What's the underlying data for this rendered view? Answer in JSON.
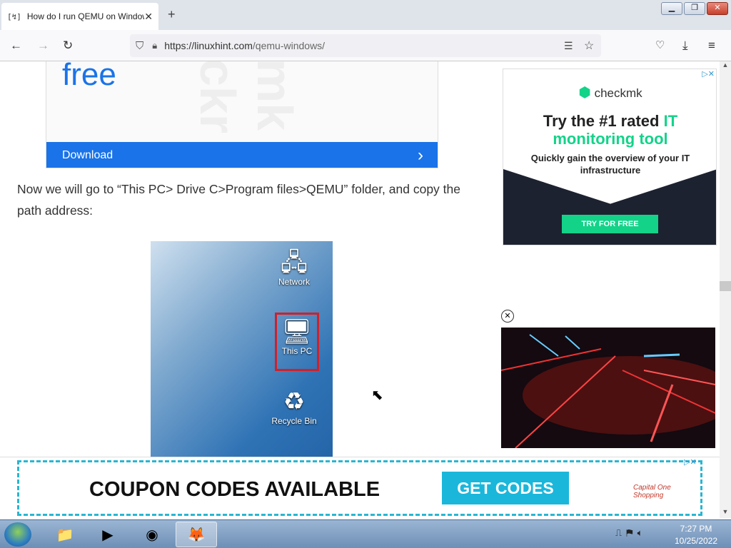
{
  "browser": {
    "tab_title": "How do I run QEMU on Windows",
    "tab_favicon": "[↯]",
    "tab_close": "✕",
    "new_tab": "+",
    "url_host": "https://linuxhint.com",
    "url_path": "/qemu-windows/",
    "window_min": "▁",
    "window_max": "❐",
    "window_close": "✕"
  },
  "page": {
    "ad_top_word": "free",
    "ad_top_watermark": "mk ckr",
    "download_label": "Download",
    "download_arrow": "›",
    "paragraph": "Now we will go to “This PC> Drive C>Program files>QEMU” folder, and copy the path address:",
    "desktop_icons": {
      "network": "Network",
      "this_pc": "This PC",
      "recycle_bin": "Recycle Bin"
    }
  },
  "sidebar_ad": {
    "brand": "checkmk",
    "headline_1": "Try the #1 rated ",
    "headline_1_accent": "IT",
    "headline_2": "monitoring tool",
    "sub": "Quickly gain the overview of your IT infrastructure",
    "cta": "TRY FOR FREE",
    "ad_choice": "▷✕",
    "close_video": "✕"
  },
  "bottom_ad": {
    "headline": "COUPON CODES AVAILABLE",
    "cta": "GET CODES",
    "brand": "Capital One Shopping",
    "ad_choice": "▷✕"
  },
  "taskbar": {
    "time": "7:27 PM",
    "date": "10/25/2022"
  },
  "colors": {
    "accent_blue": "#1a73e8",
    "checkmk_green": "#13d389",
    "coupon_blue": "#1ab7db"
  }
}
